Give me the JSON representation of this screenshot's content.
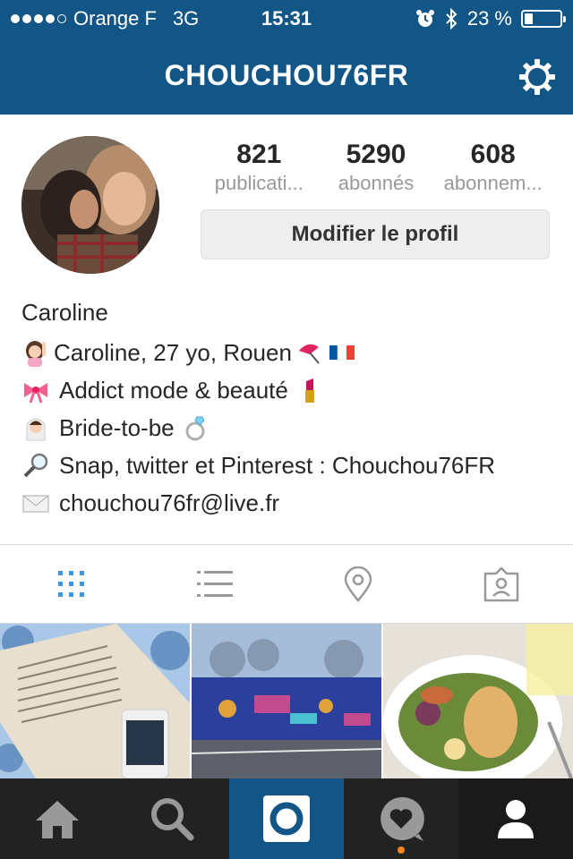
{
  "status_bar": {
    "carrier": "Orange F",
    "network": "3G",
    "time": "15:31",
    "battery": "23 %",
    "battery_level": 0.23
  },
  "nav": {
    "title": "CHOUCHOU76FR",
    "settings_icon": "gear-icon"
  },
  "profile": {
    "stats": [
      {
        "value": "821",
        "label": "publicati..."
      },
      {
        "value": "5290",
        "label": "abonnés"
      },
      {
        "value": "608",
        "label": "abonnem..."
      }
    ],
    "edit_button": "Modifier le profil"
  },
  "bio": {
    "name": "Caroline",
    "lines": [
      {
        "icon": "woman-raising-hand-emoji",
        "text": "Caroline, 27 yo, Rouen"
      },
      {
        "icon": "ribbon-emoji",
        "text": "Addict mode & beauté"
      },
      {
        "icon": "bride-emoji",
        "text": "Bride-to-be"
      },
      {
        "icon": "magnifier-emoji",
        "text": "Snap, twitter et Pinterest : Chouchou76FR"
      },
      {
        "icon": "envelope-emoji",
        "text": "chouchou76fr@live.fr"
      }
    ]
  },
  "tabs": [
    "grid-icon",
    "list-icon",
    "location-pin-icon",
    "tagged-person-icon"
  ],
  "colors": {
    "brand": "#125688",
    "active_tab": "#3897f0",
    "inactive": "#999999",
    "bottom_bar": "#222222",
    "notification": "#f58220"
  },
  "bottom_nav": [
    "home-icon",
    "search-icon",
    "camera-icon",
    "activity-heart-icon",
    "profile-icon"
  ]
}
